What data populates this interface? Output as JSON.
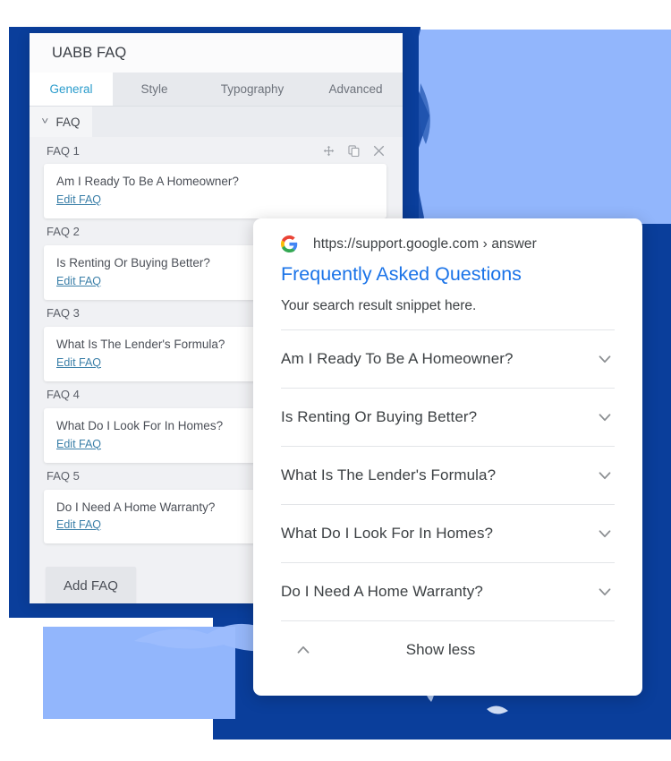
{
  "colors": {
    "dark_blue": "#0A3E9B",
    "light_blue": "#92B6FC",
    "accent_tab": "#2b9ccc",
    "link_blue": "#1a73e8",
    "edit_link": "#3b7fa8"
  },
  "settings_panel": {
    "title": "UABB FAQ",
    "tabs": [
      {
        "label": "General",
        "active": true
      },
      {
        "label": "Style",
        "active": false
      },
      {
        "label": "Typography",
        "active": false
      },
      {
        "label": "Advanced",
        "active": false
      }
    ],
    "section": {
      "label": "FAQ",
      "chevron_icon": "chevron-down-icon"
    },
    "row_tools": [
      {
        "icon": "move-icon",
        "title": "Move"
      },
      {
        "icon": "duplicate-icon",
        "title": "Duplicate"
      },
      {
        "icon": "close-icon",
        "title": "Remove"
      }
    ],
    "items": [
      {
        "name": "FAQ 1",
        "question": "Am I Ready To Be A Homeowner?",
        "edit_label": "Edit FAQ"
      },
      {
        "name": "FAQ 2",
        "question": "Is Renting Or Buying Better?",
        "edit_label": "Edit FAQ"
      },
      {
        "name": "FAQ 3",
        "question": "What Is The Lender's Formula?",
        "edit_label": "Edit FAQ"
      },
      {
        "name": "FAQ 4",
        "question": "What Do I Look For In Homes?",
        "edit_label": "Edit FAQ"
      },
      {
        "name": "FAQ 5",
        "question": "Do I Need A Home Warranty?",
        "edit_label": "Edit FAQ"
      }
    ],
    "add_button_label": "Add FAQ"
  },
  "google_card": {
    "favicon_icon": "google-g-icon",
    "url": "https://support.google.com › answer",
    "title": "Frequently Asked Questions",
    "snippet": "Your search result snippet here.",
    "questions": [
      {
        "text": "Am I Ready To Be A Homeowner?",
        "chevron_icon": "chevron-down-icon"
      },
      {
        "text": "Is Renting Or Buying Better?",
        "chevron_icon": "chevron-down-icon"
      },
      {
        "text": "What Is The Lender's Formula?",
        "chevron_icon": "chevron-down-icon"
      },
      {
        "text": "What Do I Look For In Homes?",
        "chevron_icon": "chevron-down-icon"
      },
      {
        "text": "Do I Need A Home Warranty?",
        "chevron_icon": "chevron-down-icon"
      }
    ],
    "show_less_label": "Show less",
    "show_less_icon": "chevron-up-icon"
  }
}
